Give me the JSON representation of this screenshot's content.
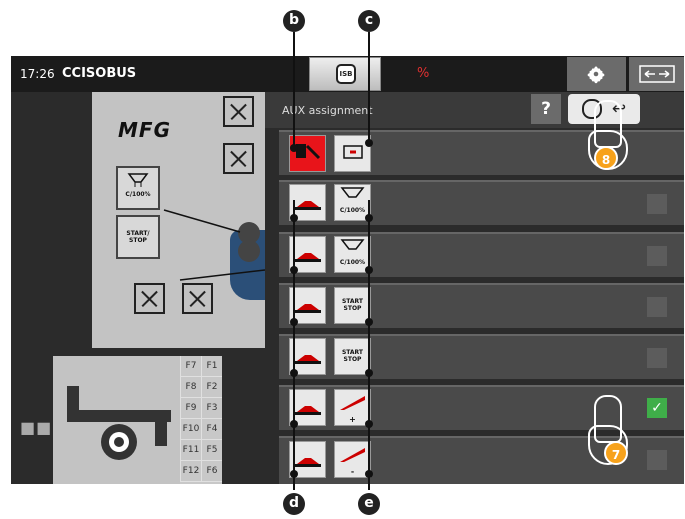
{
  "topbar": {
    "time": "17:26",
    "brand": "CCISOBUS",
    "isb_label": "ISB"
  },
  "mask": {
    "logo": "MFG",
    "softkey_c100": "C/100%",
    "softkey_startstop": "START/ STOP"
  },
  "fkeys": [
    "F7",
    "F1",
    "F8",
    "F2",
    "F9",
    "F3",
    "F10",
    "F4",
    "F11",
    "F5",
    "F12",
    "F6"
  ],
  "aux": {
    "title": "AUX assignment",
    "help_label": "?",
    "back_label": "↩"
  },
  "rows": [
    {
      "right_label": ""
    },
    {
      "right_label": "C/100%"
    },
    {
      "right_label": "C/100%"
    },
    {
      "right_label": "START STOP"
    },
    {
      "right_label": "START STOP"
    },
    {
      "right_label": "+"
    },
    {
      "right_label": "-"
    }
  ],
  "callouts": {
    "b": "b",
    "c": "c",
    "d": "d",
    "e": "e",
    "badge7": "7",
    "badge8": "8"
  },
  "colors": {
    "checkbox_checked": "#3fae49",
    "badge": "#f7a21b",
    "row_icon_red": "#e8141a"
  },
  "icons": [
    "gear-icon",
    "swap-screen-icon",
    "isb-icon",
    "checkmark-icon",
    "hand-pointer-icon"
  ]
}
